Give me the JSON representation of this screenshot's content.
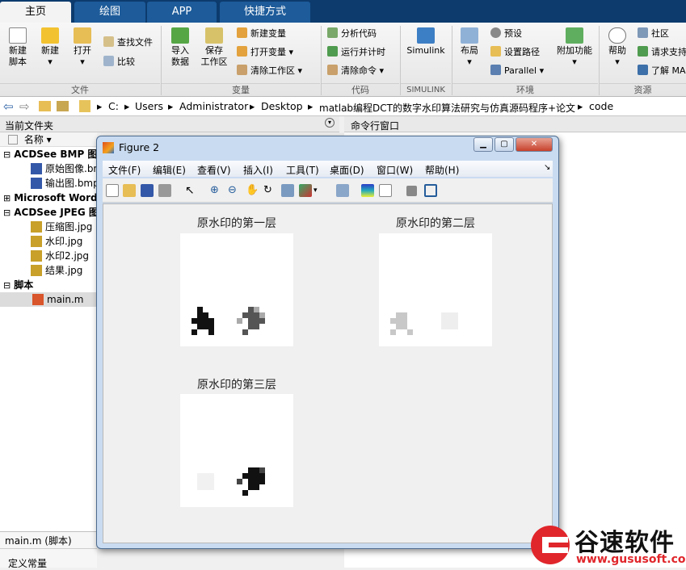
{
  "ribbon_tabs": [
    "主页",
    "绘图",
    "APP",
    "快捷方式"
  ],
  "ribbon": {
    "new_script": "新建\n脚本",
    "new": "新建",
    "open": "打开",
    "find_files": "查找文件",
    "compare": "比较",
    "import_data": "导入\n数据",
    "save_workspace": "保存\n工作区",
    "new_variable": "新建变量",
    "open_variable": "打开变量",
    "clear_workspace": "清除工作区",
    "analyze_code": "分析代码",
    "run_and_time": "运行并计时",
    "clear_commands": "清除命令",
    "simulink": "Simulink",
    "layout": "布局",
    "preferences": "预设",
    "set_path": "设置路径",
    "parallel": "Parallel",
    "add_ons": "附加功能",
    "help": "帮助",
    "community": "社区",
    "request_support": "请求支持",
    "learn_matlab": "了解 MA",
    "groups": {
      "file": "文件",
      "variable": "变量",
      "code": "代码",
      "simulink": "SIMULINK",
      "environment": "环境",
      "resources": "资源"
    }
  },
  "address": {
    "parts": [
      "C:",
      "Users",
      "Administrator",
      "Desktop",
      "matlab编程DCT的数字水印算法研究与仿真源码程序+论文",
      "code"
    ]
  },
  "current_folder": {
    "title": "当前文件夹",
    "name_col": "名称 ▾"
  },
  "command_window": {
    "title": "命令行窗口"
  },
  "files": [
    {
      "label": "ACDSee BMP 图像",
      "group": true
    },
    {
      "label": "原始图像.bmp",
      "icon": "BMP"
    },
    {
      "label": "输出图.bmp",
      "icon": "BMP"
    },
    {
      "label": "Microsoft Word",
      "group": true
    },
    {
      "label": "ACDSee JPEG 图像",
      "group": true
    },
    {
      "label": "压缩图.jpg",
      "icon": "JPEG"
    },
    {
      "label": "水印.jpg",
      "icon": "JPEG"
    },
    {
      "label": "水印2.jpg",
      "icon": "JPEG"
    },
    {
      "label": "结果.jpg",
      "icon": "JPEG"
    },
    {
      "label": "脚本",
      "group": true
    },
    {
      "label": "main.m",
      "icon": "m"
    }
  ],
  "details": {
    "file": "main.m  (脚本)",
    "line2": "定义常量"
  },
  "figure": {
    "title": "Figure 2",
    "menus": [
      "文件(F)",
      "编辑(E)",
      "查看(V)",
      "插入(I)",
      "工具(T)",
      "桌面(D)",
      "窗口(W)",
      "帮助(H)"
    ],
    "plots": [
      {
        "title": "原水印的第一层"
      },
      {
        "title": "原水印的第二层"
      },
      {
        "title": "原水印的第三层"
      }
    ]
  },
  "watermark": {
    "brand": "谷速软件",
    "url": "www.gususoft.com",
    "color": "#e0262b"
  }
}
